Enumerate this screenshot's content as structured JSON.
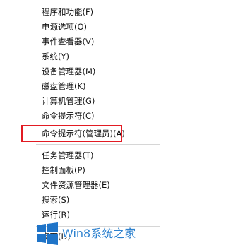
{
  "menu": {
    "items": [
      "程序和功能(F)",
      "电源选项(O)",
      "事件查看器(V)",
      "系统(Y)",
      "设备管理器(M)",
      "磁盘管理(K)",
      "计算机管理(G)",
      "命令提示符(C)",
      "命令提示符(管理员)(A)",
      "任务管理器(T)",
      "控制面板(P)",
      "文件资源管理器(E)",
      "搜索(S)",
      "运行(R)",
      "桌面(D)"
    ],
    "highlighted_item": "命令提示符(管理员)(A)"
  },
  "watermark": {
    "text": "Win8系统之家",
    "logo": "windows-logo-icon"
  },
  "colors": {
    "highlight_border": "#e21b23",
    "watermark_text": "#2e82cf",
    "logo_blue": "#1f74c8"
  }
}
